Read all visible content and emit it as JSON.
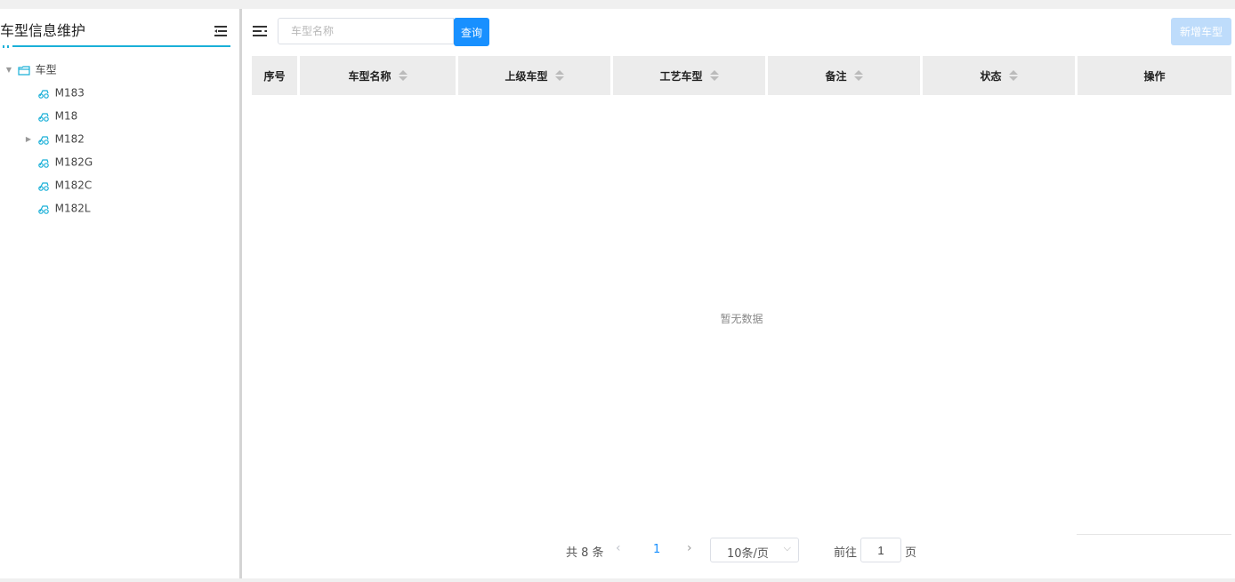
{
  "sidebar": {
    "title": "车型信息维护",
    "tree": {
      "root": "车型",
      "children": [
        {
          "label": "M183",
          "expandable": false
        },
        {
          "label": "M18",
          "expandable": false
        },
        {
          "label": "M182",
          "expandable": true
        },
        {
          "label": "M182G",
          "expandable": false
        },
        {
          "label": "M182C",
          "expandable": false
        },
        {
          "label": "M182L",
          "expandable": false
        }
      ]
    }
  },
  "toolbar": {
    "search_placeholder": "车型名称",
    "search_value": "",
    "search_label": "查询",
    "add_label": "新增车型"
  },
  "table": {
    "columns": [
      {
        "label": "序号",
        "sortable": false
      },
      {
        "label": "车型名称",
        "sortable": true
      },
      {
        "label": "上级车型",
        "sortable": true
      },
      {
        "label": "工艺车型",
        "sortable": true
      },
      {
        "label": "备注",
        "sortable": true
      },
      {
        "label": "状态",
        "sortable": true
      },
      {
        "label": "操作",
        "sortable": false
      }
    ],
    "rows": [],
    "empty_text": "暂无数据"
  },
  "pagination": {
    "total_text": "共 8 条",
    "current_page": "1",
    "page_size": "10条/页",
    "goto_label": "前往",
    "goto_value": "1",
    "goto_unit": "页"
  },
  "colors": {
    "primary": "#1890ff",
    "accent_underline": "#1ab0d8",
    "disabled_button": "#bedcfb",
    "header_bg": "#ececec"
  }
}
